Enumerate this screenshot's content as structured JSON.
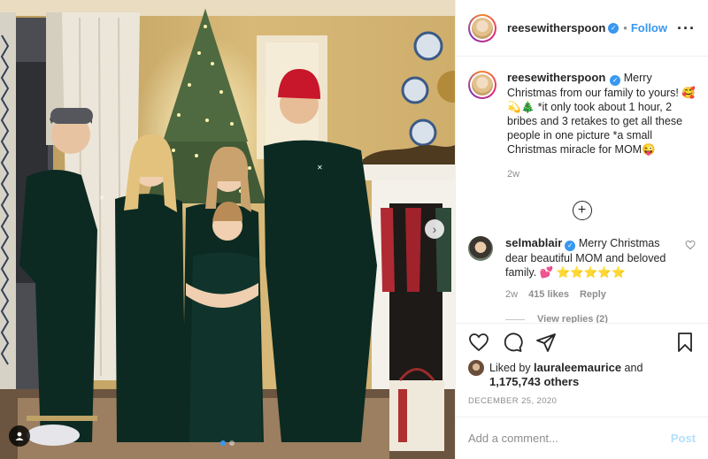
{
  "photo": {
    "alt_icon": "person-tag-icon",
    "carousel": {
      "count": 2,
      "active": 1
    },
    "next_icon": "chevron-right-icon"
  },
  "header": {
    "username": "reesewitherspoon",
    "verified_icon": "verified-badge-icon",
    "separator": "•",
    "follow_label": "Follow",
    "more_icon": "more-options-icon"
  },
  "caption": {
    "username": "reesewitherspoon",
    "text": "Merry Christmas from our family to yours! 🥰💫🎄 *it only took about 1 hour, 2 bribes and 3 retakes to get all these people in one picture *a small Christmas miracle for MOM😜",
    "time": "2w"
  },
  "load_more_icon": "plus-circle-icon",
  "comment": {
    "username": "selmablair",
    "text": "Merry Christmas dear beautiful MOM and beloved family. 💕 ⭐⭐⭐⭐⭐",
    "time": "2w",
    "likes": "415 likes",
    "reply_label": "Reply",
    "view_replies": "View replies (2)"
  },
  "actions": {
    "like_icon": "heart-icon",
    "comment_icon": "comment-icon",
    "share_icon": "share-icon",
    "save_icon": "bookmark-icon"
  },
  "likes": {
    "prefix": "Liked by",
    "user": "lauraleemaurice",
    "and": "and",
    "count": "1,175,743 others"
  },
  "date": "DECEMBER 25, 2020",
  "add_comment": {
    "placeholder": "Add a comment...",
    "post_label": "Post"
  },
  "colors": {
    "accent": "#3897f0",
    "post_disabled": "#b2dffc",
    "text": "#262626",
    "muted": "#8e8e8e"
  }
}
